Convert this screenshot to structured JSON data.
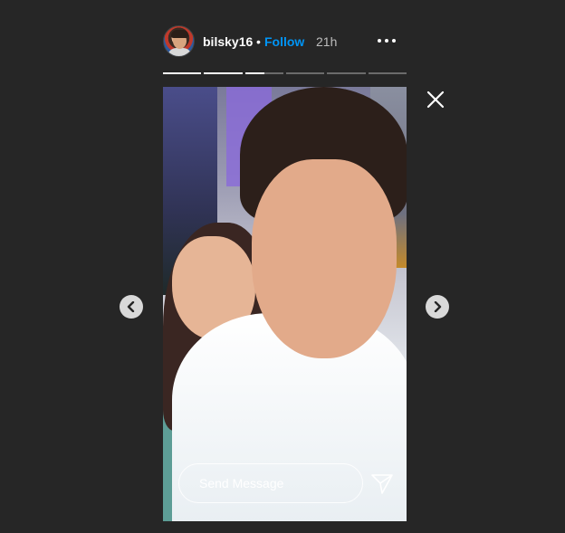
{
  "header": {
    "username": "bilsky16",
    "separator": "•",
    "follow_label": "Follow",
    "time": "21h",
    "avatar_icon": "profile-avatar",
    "more_icon": "more-horizontal-icon"
  },
  "progress": {
    "segments": [
      1,
      1,
      0.5,
      0,
      0,
      0
    ],
    "current_index": 2
  },
  "story": {
    "image_alt": "story-photo"
  },
  "reply": {
    "placeholder": "Send Message",
    "send_icon": "paper-plane-icon"
  },
  "controls": {
    "close_icon": "close-icon",
    "prev_icon": "chevron-left-icon",
    "next_icon": "chevron-right-icon"
  },
  "colors": {
    "background": "#262626",
    "follow": "#0095f6",
    "progress_fill": "#ffffff",
    "progress_track": "#6b6b6b"
  }
}
